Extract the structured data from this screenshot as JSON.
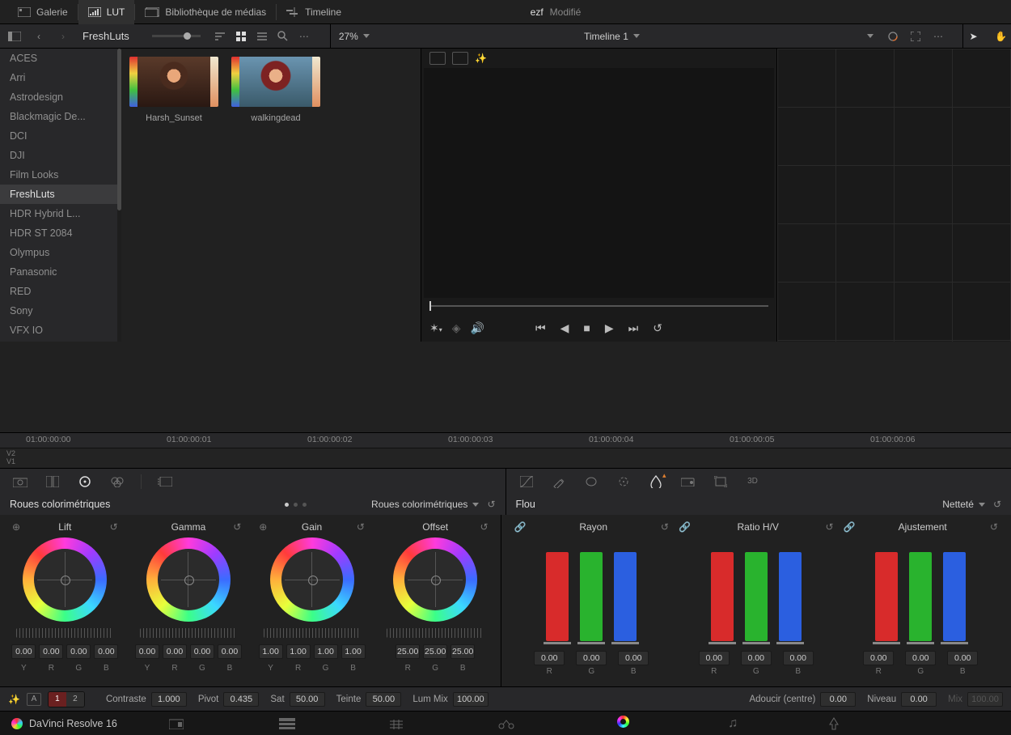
{
  "top": {
    "galerie": "Galerie",
    "lut": "LUT",
    "media": "Bibliothèque de médias",
    "timeline": "Timeline",
    "project": "ezf",
    "modified": "Modifié"
  },
  "sub": {
    "breadcrumb": "FreshLuts",
    "zoom": "27%",
    "timeline_name": "Timeline 1"
  },
  "sidebar": {
    "items": [
      "ACES",
      "Arri",
      "Astrodesign",
      "Blackmagic De...",
      "DCI",
      "DJI",
      "Film Looks",
      "FreshLuts",
      "HDR Hybrid L...",
      "HDR ST 2084",
      "Olympus",
      "Panasonic",
      "RED",
      "Sony",
      "VFX IO"
    ],
    "active": 7
  },
  "thumbs": [
    {
      "name": "Harsh_Sunset"
    },
    {
      "name": "walkingdead"
    }
  ],
  "ruler": [
    "01:00:00:00",
    "01:00:00:01",
    "01:00:00:02",
    "01:00:00:03",
    "01:00:00:04",
    "01:00:00:05",
    "01:00:00:06"
  ],
  "tracks": [
    "V2",
    "V1"
  ],
  "wheels_panel": {
    "title": "Roues colorimétriques",
    "mode": "Roues colorimétriques"
  },
  "blur_panel": {
    "title": "Flou",
    "mode": "Netteté"
  },
  "wheels": [
    {
      "name": "Lift",
      "vals": [
        "0.00",
        "0.00",
        "0.00",
        "0.00"
      ],
      "labels": [
        "Y",
        "R",
        "G",
        "B"
      ]
    },
    {
      "name": "Gamma",
      "vals": [
        "0.00",
        "0.00",
        "0.00",
        "0.00"
      ],
      "labels": [
        "Y",
        "R",
        "G",
        "B"
      ]
    },
    {
      "name": "Gain",
      "vals": [
        "1.00",
        "1.00",
        "1.00",
        "1.00"
      ],
      "labels": [
        "Y",
        "R",
        "G",
        "B"
      ]
    },
    {
      "name": "Offset",
      "vals": [
        "25.00",
        "25.00",
        "25.00"
      ],
      "labels": [
        "R",
        "G",
        "B"
      ]
    }
  ],
  "blur_cols": [
    {
      "name": "Rayon",
      "vals": [
        "0.00",
        "0.00",
        "0.00"
      ]
    },
    {
      "name": "Ratio H/V",
      "vals": [
        "0.00",
        "0.00",
        "0.00"
      ]
    },
    {
      "name": "Ajustement",
      "vals": [
        "0.00",
        "0.00",
        "0.00"
      ]
    }
  ],
  "blur_labels": [
    "R",
    "G",
    "B"
  ],
  "adjust": {
    "seg": [
      "1",
      "2"
    ],
    "contraste_l": "Contraste",
    "contraste": "1.000",
    "pivot_l": "Pivot",
    "pivot": "0.435",
    "sat_l": "Sat",
    "sat": "50.00",
    "teinte_l": "Teinte",
    "teinte": "50.00",
    "lummix_l": "Lum Mix",
    "lummix": "100.00",
    "adoucir_l": "Adoucir (centre)",
    "adoucir": "0.00",
    "niveau_l": "Niveau",
    "niveau": "0.00",
    "mix_l": "Mix",
    "mix": "100.00"
  },
  "footer": {
    "brand": "DaVinci Resolve 16"
  }
}
